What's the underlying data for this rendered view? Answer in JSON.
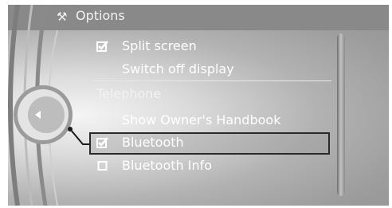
{
  "header": {
    "title": "Options",
    "icon": "options-icon"
  },
  "menu": {
    "items": [
      {
        "label": "Split screen",
        "type": "checkbox",
        "checked": true
      },
      {
        "label": "Switch off display",
        "type": "action"
      }
    ],
    "section": {
      "title": "Telephone",
      "items": [
        {
          "label": "Show Owner's Handbook",
          "type": "action"
        },
        {
          "label": "Bluetooth",
          "type": "checkbox",
          "checked": true,
          "selected": true
        },
        {
          "label": "Bluetooth Info",
          "type": "checkbox",
          "checked": false
        }
      ]
    }
  },
  "colors": {
    "title_bar": "#898989",
    "text": "#ffffff",
    "focus_frame": "#2a2a2a"
  }
}
